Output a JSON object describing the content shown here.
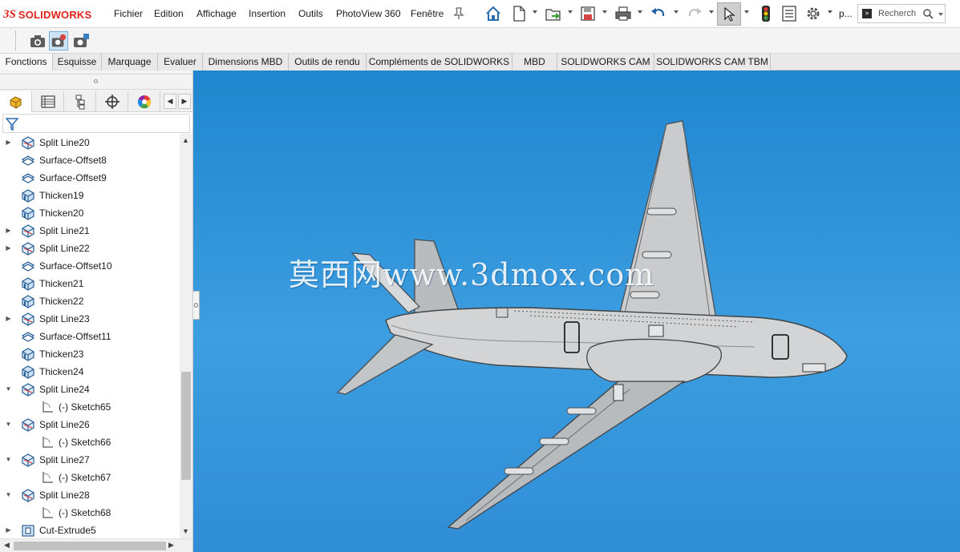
{
  "app": {
    "logo_ds": "3S",
    "logo_text": "SOLIDWORKS",
    "search_placeholder": "Recherch",
    "overflow_label": "p..."
  },
  "menu": {
    "items": [
      "Fichier",
      "Edition",
      "Affichage",
      "Insertion",
      "Outils",
      "PhotoView 360",
      "Fenêtre"
    ]
  },
  "toolbar": {
    "icons": [
      "home-icon",
      "new-document-icon",
      "open-icon",
      "save-icon",
      "print-icon",
      "undo-icon",
      "redo-icon",
      "select-pointer-icon",
      "traffic-light-icon",
      "file-properties-icon",
      "options-gear-icon"
    ]
  },
  "command_tabs": [
    "Fonctions",
    "Esquisse",
    "Marquage",
    "Evaluer",
    "Dimensions MBD",
    "Outils de rendu",
    "Compléments de SOLIDWORKS",
    "MBD",
    "SOLIDWORKS CAM",
    "SOLIDWORKS CAM TBM"
  ],
  "feature_tree": {
    "items": [
      {
        "label": "Split Line20",
        "icon": "split-line-icon",
        "expander": "▶",
        "indent": 0
      },
      {
        "label": "Surface-Offset8",
        "icon": "surface-offset-icon",
        "expander": "",
        "indent": 0
      },
      {
        "label": "Surface-Offset9",
        "icon": "surface-offset-icon",
        "expander": "",
        "indent": 0
      },
      {
        "label": "Thicken19",
        "icon": "thicken-icon",
        "expander": "",
        "indent": 0
      },
      {
        "label": "Thicken20",
        "icon": "thicken-icon",
        "expander": "",
        "indent": 0
      },
      {
        "label": "Split Line21",
        "icon": "split-line-icon",
        "expander": "▶",
        "indent": 0
      },
      {
        "label": "Split Line22",
        "icon": "split-line-icon",
        "expander": "▶",
        "indent": 0
      },
      {
        "label": "Surface-Offset10",
        "icon": "surface-offset-icon",
        "expander": "",
        "indent": 0
      },
      {
        "label": "Thicken21",
        "icon": "thicken-icon",
        "expander": "",
        "indent": 0
      },
      {
        "label": "Thicken22",
        "icon": "thicken-icon",
        "expander": "",
        "indent": 0
      },
      {
        "label": "Split Line23",
        "icon": "split-line-icon",
        "expander": "▶",
        "indent": 0
      },
      {
        "label": "Surface-Offset11",
        "icon": "surface-offset-icon",
        "expander": "",
        "indent": 0
      },
      {
        "label": "Thicken23",
        "icon": "thicken-icon",
        "expander": "",
        "indent": 0
      },
      {
        "label": "Thicken24",
        "icon": "thicken-icon",
        "expander": "",
        "indent": 0
      },
      {
        "label": "Split Line24",
        "icon": "split-line-icon",
        "expander": "▼",
        "indent": 0
      },
      {
        "label": "(-) Sketch65",
        "icon": "sketch-icon",
        "expander": "",
        "indent": 1
      },
      {
        "label": "Split Line26",
        "icon": "split-line-icon",
        "expander": "▼",
        "indent": 0
      },
      {
        "label": "(-) Sketch66",
        "icon": "sketch-icon",
        "expander": "",
        "indent": 1
      },
      {
        "label": "Split Line27",
        "icon": "split-line-icon",
        "expander": "▼",
        "indent": 0
      },
      {
        "label": "(-) Sketch67",
        "icon": "sketch-icon",
        "expander": "",
        "indent": 1
      },
      {
        "label": "Split Line28",
        "icon": "split-line-icon",
        "expander": "▼",
        "indent": 0
      },
      {
        "label": "(-) Sketch68",
        "icon": "sketch-icon",
        "expander": "",
        "indent": 1
      },
      {
        "label": "Cut-Extrude5",
        "icon": "cut-extrude-icon",
        "expander": "▶",
        "indent": 0
      }
    ]
  },
  "viewport": {
    "watermark": "莫西网www.3dmox.com",
    "model": "aircraft-model"
  },
  "colors": {
    "brand_red": "#e2231a",
    "viewport_blue": "#2f8dd6",
    "model_gray": "#c9cbcd"
  }
}
